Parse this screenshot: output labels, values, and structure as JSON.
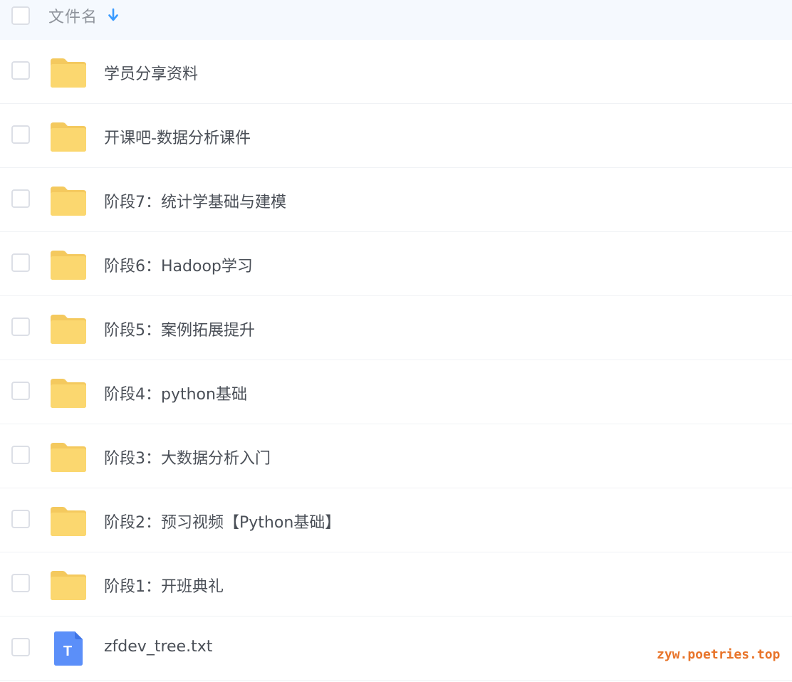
{
  "header": {
    "column_label": "文件名",
    "sort_icon": "arrow-down-icon"
  },
  "files": [
    {
      "name": "学员分享资料",
      "type": "folder",
      "icon": "folder-icon"
    },
    {
      "name": "开课吧-数据分析课件",
      "type": "folder",
      "icon": "folder-icon"
    },
    {
      "name": "阶段7：统计学基础与建模",
      "type": "folder",
      "icon": "folder-icon"
    },
    {
      "name": "阶段6：Hadoop学习",
      "type": "folder",
      "icon": "folder-icon"
    },
    {
      "name": "阶段5：案例拓展提升",
      "type": "folder",
      "icon": "folder-icon"
    },
    {
      "name": "阶段4：python基础",
      "type": "folder",
      "icon": "folder-icon"
    },
    {
      "name": "阶段3：大数据分析入门",
      "type": "folder",
      "icon": "folder-icon"
    },
    {
      "name": "阶段2：预习视频【Python基础】",
      "type": "folder",
      "icon": "folder-icon"
    },
    {
      "name": "阶段1：开班典礼",
      "type": "folder",
      "icon": "folder-icon"
    },
    {
      "name": "zfdev_tree.txt",
      "type": "txt",
      "icon": "text-file-icon",
      "icon_letter": "T"
    }
  ],
  "watermark": "zyw.poetries.top",
  "colors": {
    "folder": "#fbd76f",
    "folder_tab": "#f4c95e",
    "txt_icon": "#5b8ff9",
    "sort_arrow": "#3a9bff",
    "watermark": "#e8742a"
  }
}
